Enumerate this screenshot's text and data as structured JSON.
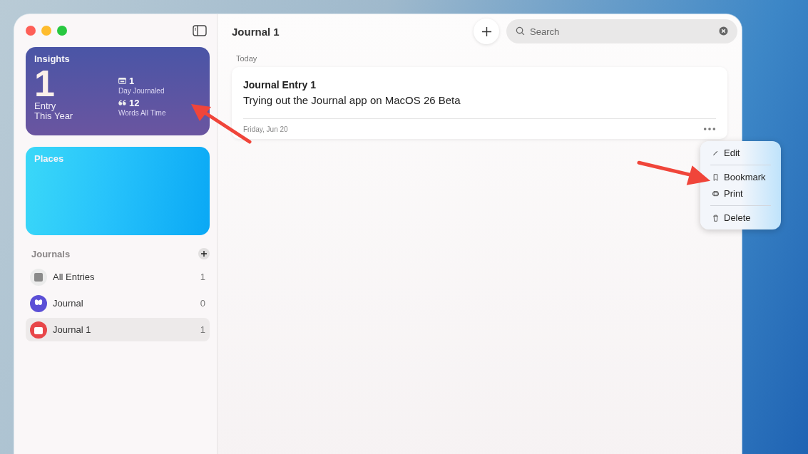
{
  "window": {
    "title": "Journal 1"
  },
  "insights": {
    "title": "Insights",
    "big_value": "1",
    "big_label_lines": [
      "Entry",
      "This Year"
    ],
    "stats": [
      {
        "value": "1",
        "label": "Day Journaled"
      },
      {
        "value": "12",
        "label": "Words All Time"
      }
    ]
  },
  "places": {
    "title": "Places"
  },
  "journals": {
    "heading": "Journals",
    "items": [
      {
        "name": "All Entries",
        "count": "1",
        "color": "#8a8a8a",
        "selected": false
      },
      {
        "name": "Journal",
        "count": "0",
        "color": "#5b4fd6",
        "selected": false
      },
      {
        "name": "Journal 1",
        "count": "1",
        "color": "#e8474a",
        "selected": true
      }
    ]
  },
  "search": {
    "placeholder": "Search"
  },
  "section_heading": "Today",
  "entry": {
    "title": "Journal Entry 1",
    "body": "Trying out the Journal app on MacOS 26 Beta",
    "date": "Friday, Jun 20"
  },
  "menu": {
    "sections": [
      {
        "items": [
          {
            "label": "Edit"
          }
        ]
      },
      {
        "items": [
          {
            "label": "Bookmark"
          },
          {
            "label": "Print"
          }
        ]
      },
      {
        "items": [
          {
            "label": "Delete"
          }
        ]
      }
    ]
  }
}
